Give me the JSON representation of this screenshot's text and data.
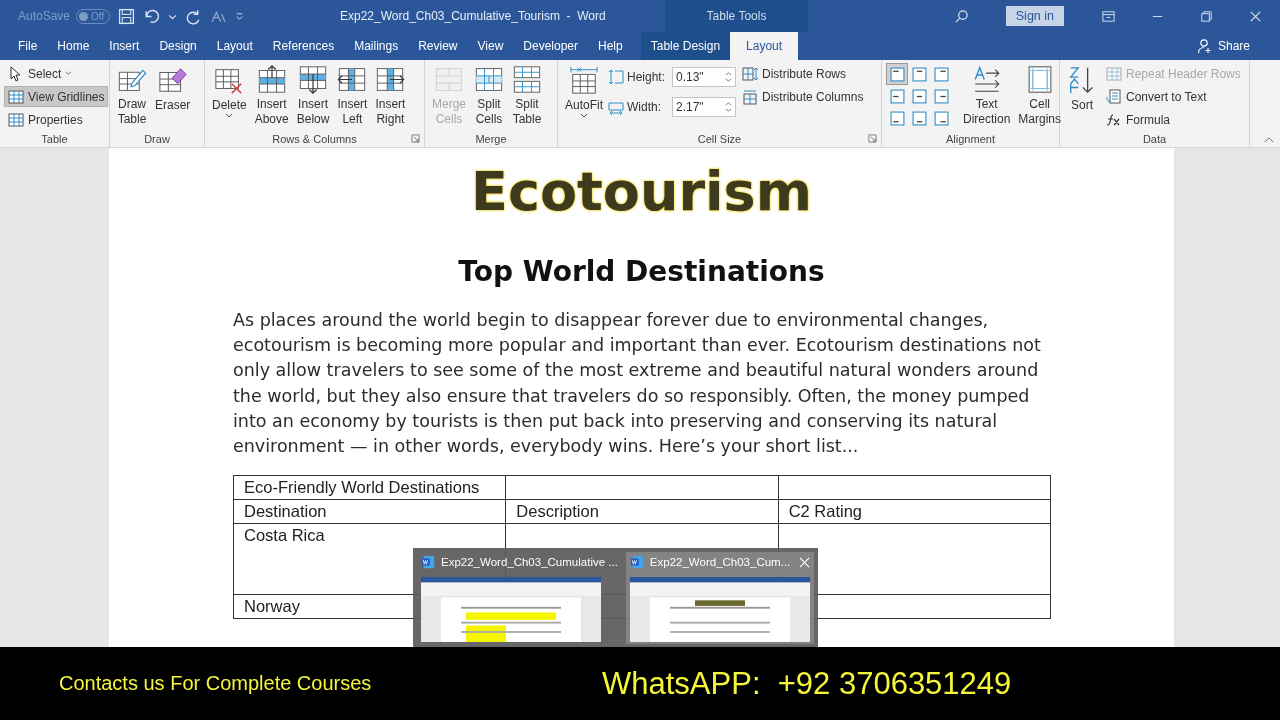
{
  "title_bar": {
    "autosave": {
      "label": "AutoSave",
      "state_text": "Off",
      "on": false
    },
    "document_title": "Exp22_Word_Ch03_Cumulative_Tourism  -  Word",
    "contextual_label": "Table Tools",
    "sign_in": "Sign in"
  },
  "tabs": [
    {
      "label": "File",
      "selected": false,
      "contextual": false
    },
    {
      "label": "Home",
      "selected": false,
      "contextual": false
    },
    {
      "label": "Insert",
      "selected": false,
      "contextual": false
    },
    {
      "label": "Design",
      "selected": false,
      "contextual": false
    },
    {
      "label": "Layout",
      "selected": false,
      "contextual": false
    },
    {
      "label": "References",
      "selected": false,
      "contextual": false
    },
    {
      "label": "Mailings",
      "selected": false,
      "contextual": false
    },
    {
      "label": "Review",
      "selected": false,
      "contextual": false
    },
    {
      "label": "View",
      "selected": false,
      "contextual": false
    },
    {
      "label": "Developer",
      "selected": false,
      "contextual": false
    },
    {
      "label": "Help",
      "selected": false,
      "contextual": false
    },
    {
      "label": "Table Design",
      "selected": false,
      "contextual": true
    },
    {
      "label": "Layout",
      "selected": true,
      "contextual": true
    }
  ],
  "share": "Share",
  "ribbon": {
    "groups": [
      {
        "name": "Table",
        "items": [
          {
            "kind": "small",
            "label": "Select",
            "dropdown": true,
            "on": false,
            "disabled": false
          },
          {
            "kind": "small",
            "label": "View Gridlines",
            "on": true,
            "disabled": false
          },
          {
            "kind": "small",
            "label": "Properties",
            "on": false,
            "disabled": false
          }
        ]
      },
      {
        "name": "Draw",
        "items": [
          {
            "kind": "large",
            "lines": [
              "Draw",
              "Table"
            ],
            "disabled": false
          },
          {
            "kind": "large",
            "lines": [
              "Eraser"
            ],
            "disabled": false
          }
        ]
      },
      {
        "name": "Rows & Columns",
        "launcher": true,
        "items": [
          {
            "kind": "large",
            "lines": [
              "Delete"
            ],
            "dropdown": true,
            "disabled": false
          },
          {
            "kind": "large",
            "lines": [
              "Insert",
              "Above"
            ],
            "disabled": false
          },
          {
            "kind": "large",
            "lines": [
              "Insert",
              "Below"
            ],
            "disabled": false
          },
          {
            "kind": "large",
            "lines": [
              "Insert",
              "Left"
            ],
            "disabled": false
          },
          {
            "kind": "large",
            "lines": [
              "Insert",
              "Right"
            ],
            "disabled": false
          }
        ]
      },
      {
        "name": "Merge",
        "items": [
          {
            "kind": "large",
            "lines": [
              "Merge",
              "Cells"
            ],
            "disabled": true
          },
          {
            "kind": "large",
            "lines": [
              "Split",
              "Cells"
            ],
            "disabled": false
          },
          {
            "kind": "large",
            "lines": [
              "Split",
              "Table"
            ],
            "disabled": false
          }
        ]
      },
      {
        "name": "Cell Size",
        "launcher": true,
        "items": [
          {
            "kind": "large",
            "lines": [
              "AutoFit"
            ],
            "dropdown": true,
            "disabled": false
          },
          {
            "kind": "field",
            "label": "Height:",
            "value": "0.13\""
          },
          {
            "kind": "field",
            "label": "Width:",
            "value": "2.17\""
          },
          {
            "kind": "small",
            "label": "Distribute Rows",
            "disabled": false
          },
          {
            "kind": "small",
            "label": "Distribute Columns",
            "disabled": false
          }
        ]
      },
      {
        "name": "Alignment",
        "items": [
          {
            "kind": "align",
            "cells": [
              {
                "selected": true
              },
              {
                "selected": false
              },
              {
                "selected": false
              },
              {
                "selected": false
              },
              {
                "selected": false
              },
              {
                "selected": false
              },
              {
                "selected": false
              },
              {
                "selected": false
              },
              {
                "selected": false
              }
            ]
          },
          {
            "kind": "large",
            "lines": [
              "Text",
              "Direction"
            ],
            "disabled": false
          },
          {
            "kind": "large",
            "lines": [
              "Cell",
              "Margins"
            ],
            "disabled": false
          }
        ]
      },
      {
        "name": "Data",
        "items": [
          {
            "kind": "large",
            "lines": [
              "Sort"
            ],
            "disabled": false
          },
          {
            "kind": "small",
            "label": "Repeat Header Rows",
            "disabled": true
          },
          {
            "kind": "small",
            "label": "Convert to Text",
            "disabled": false
          },
          {
            "kind": "small",
            "label": "Formula",
            "disabled": false
          }
        ]
      }
    ]
  },
  "document": {
    "heading": "Ecotourism",
    "subheading": "Top World Destinations",
    "paragraph": "As places around the world begin to disappear forever due to environmental changes, ecotourism is becoming more popular and important than ever. Ecotourism destinations not only allow travelers to see some of the most extreme and beautiful natural wonders around the world, but they also ensure that travelers do so responsibly. Often, the money pumped into an economy by tourists is then put back into preserving and conserving its natural environment — in other words, everybody wins. Here’s your short list...",
    "table": {
      "rows": [
        {
          "column_1": "Eco-Friendly World Destinations"
        },
        {
          "column_1": "Destination",
          "column_2": "Description",
          "column_3": "C2 Rating"
        },
        {
          "column_1": "Costa Rica"
        },
        {
          "column_1": "Norway"
        }
      ]
    }
  },
  "taskbar_preview": {
    "windows": [
      {
        "title": "Exp22_Word_Ch03_Cumulative ...",
        "selected": false
      },
      {
        "title": "Exp22_Word_Ch03_Cum...",
        "selected": true
      }
    ]
  },
  "promo_banner": {
    "left": "Contacts us For Complete Courses",
    "right": "WhatsAPP:  +92 3706351249"
  }
}
